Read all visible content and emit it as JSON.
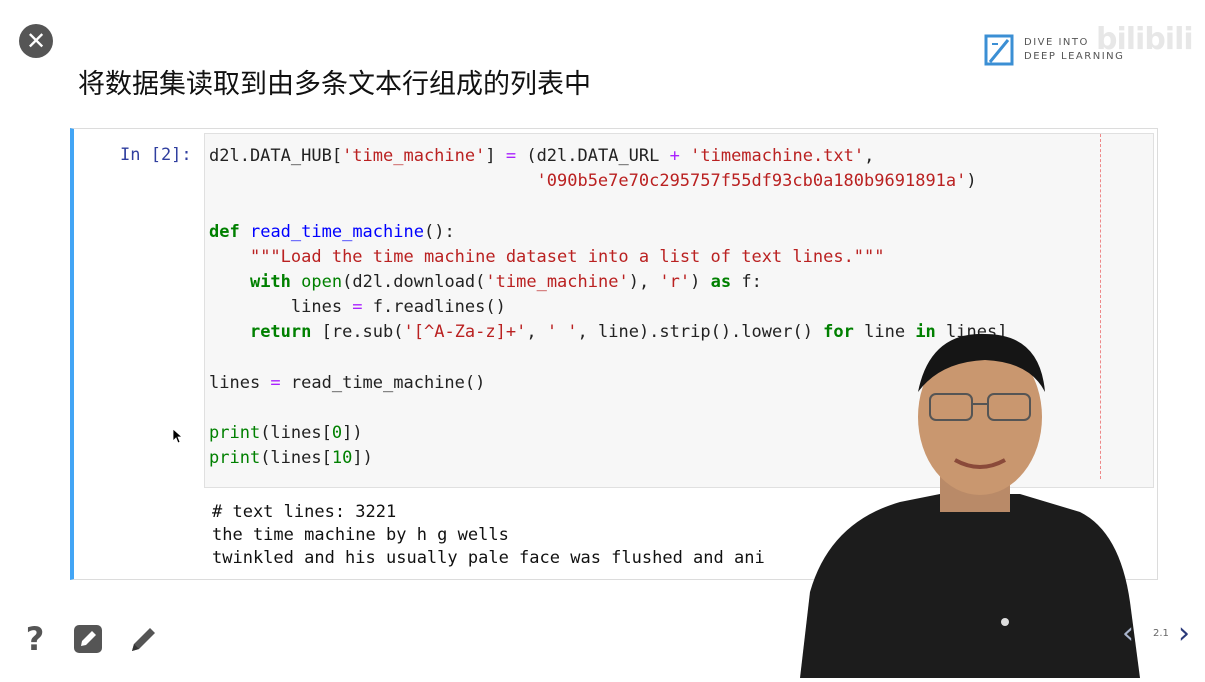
{
  "window": {
    "close_icon": "close-icon"
  },
  "logo": {
    "line1": "DIVE INTO",
    "line2": "DEEP LEARNING"
  },
  "watermark": "bilibili",
  "slide_title": "将数据集读取到由多条文本行组成的列表中",
  "cell": {
    "prompt": "In [2]:",
    "output_lines": [
      "# text lines: 3221",
      "the time machine by h g wells",
      "twinkled and his usually pale face was flushed and ani"
    ]
  },
  "toolbar": {
    "help_icon": "question-icon",
    "edit_icon": "edit-box-icon",
    "pencil_icon": "pencil-icon"
  },
  "navigation": {
    "page": "2.1",
    "prev_icon": "chevron-left-icon",
    "next_icon": "chevron-right-icon"
  },
  "colors": {
    "cell_accent": "#42a5f5",
    "prompt": "#303f9f",
    "keyword": "#008000",
    "string": "#ba2121",
    "function": "#0000ff"
  }
}
